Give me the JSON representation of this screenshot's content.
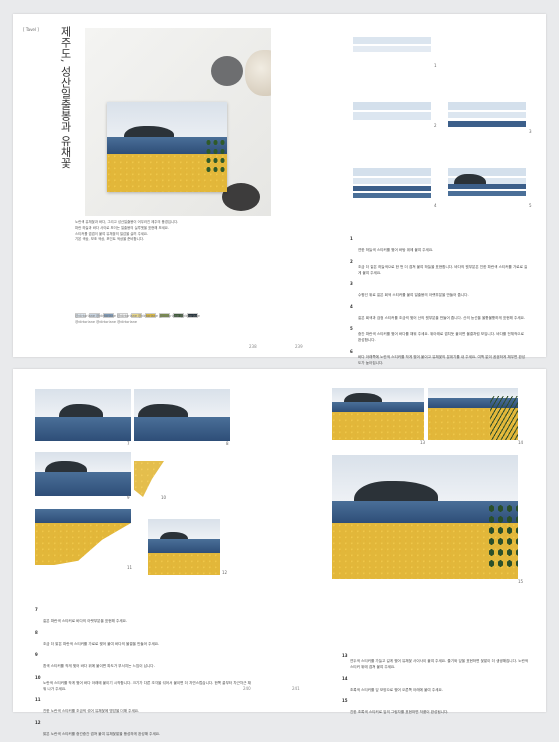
{
  "top_left": {
    "tag": "[ Tavel ]",
    "title": "제주도, 성산일출봉과 유채꽃",
    "intro_lines": [
      "노란색 유채꽃과 바다, 그리고 성산일출봉이 어우러진 제주의 풍경입니다.",
      "파란 하늘과 바다 사이로 보이는 일출봉의 실루엣을 표현해 보세요.",
      "스티커를 겹겹이 붙여 유채꽃의 질감을 살려 주세요.",
      "기본 색상, 보조 색상, 포인트 색상을 준비합니다."
    ],
    "palette": [
      "#dde6ee",
      "#c7d3df",
      "#7f9bb8",
      "#eff0f0",
      "#e6d58a",
      "#d8b845",
      "#7a8d4a",
      "#3f5b3a",
      "#26343d"
    ],
    "credits": "@dirtorlane @dirtorlane @dirtorlane @dirtorlane @dirtorlane @dirtorlane\n@dirtorlane @dirtorlane @dirtorlane",
    "page_number": "238"
  },
  "top_right": {
    "page_number": "239",
    "step_numbers": [
      "1",
      "2",
      "3",
      "4",
      "5",
      "6"
    ],
    "steps": [
      "연한 하늘색 스티커를 찢어 바탕 위에 붙여 주세요.",
      "조금 더 짙은 하늘색으로 한 번 더 겹쳐 붙여 하늘을 표현합니다. 바다의 윗부분은 진한 파란색 스티커를 가로로 길게 붙여 주세요.",
      "수평선 위로 짙은 회색 스티커를 붙여 일출봉의 아랫부분을 만들어 줍니다.",
      "짙은 회색과 검정 스티커를 조금씩 찢어 산의 윗부분을 만들어 줍니다. 산의 능선을 울퉁불퉁하게 표현해 주세요.",
      "중간 파란색 스티커를 찢어 바다를 채워 주세요. 위아래로 겹치듯 붙이면 물결처럼 보입니다. 바다를 전체적으로 완성합니다.",
      "바다 아래쪽에 노란색 스티커를 작게 찢어 붙이고 유채꽃의 분위기를 내 주세요. 여백 없이 꼼꼼하게 채우면 완성도가 높아집니다."
    ],
    "fig_labels": [
      "1",
      "2",
      "3",
      "4",
      "5",
      "6"
    ]
  },
  "bottom_left": {
    "page_number": "240",
    "fig_labels": [
      "7",
      "8",
      "9",
      "10",
      "11",
      "12"
    ],
    "step_numbers": [
      "7",
      "8",
      "9",
      "10",
      "11",
      "12"
    ],
    "steps": [
      "짙은 파란색 스티커로 바다의 아랫부분을 표현해 주세요.",
      "조금 더 밝은 파란색 스티커를 가로로 찢어 붙여 바다의 물결을 만들어 주세요.",
      "흰색 스티커를 작게 찢어 바다 위에 붙이면 파도가 부서지는 느낌이 납니다.",
      "노란색 스티커를 작게 찢어 바다 아래에 붙이기 시작합니다. 크기가 다른 조각을 섞어서 붙이면 더 자연스럽습니다. 한쪽 끝부터 차근차근 채워 나가 주세요.",
      "진한 노란색 스티커를 조금씩 섞어 유채꽃에 명암을 더해 주세요.",
      "밝은 노란색 스티커를 중간중간 겹쳐 붙여 유채꽃밭을 풍성하게 완성해 주세요."
    ]
  },
  "bottom_right": {
    "page_number": "241",
    "fig_labels": [
      "13",
      "14",
      "15"
    ],
    "step_numbers": [
      "13",
      "14",
      "15"
    ],
    "steps": [
      "연두색 스티커를 가늘고 길게 찢어 유채꽃 사이사이 붙여 주세요. 줄기와 잎을 표현하면 꽃밭이 더 생생해집니다. 노란색 스티커 위에 겹쳐 붙여 주세요.",
      "초록색 스티커를 잎 모양으로 찢어 오른쪽 아래에 붙여 주세요.",
      "진한 초록색 스티커로 잎의 그림자를 표현하면 작품이 완성됩니다."
    ]
  }
}
